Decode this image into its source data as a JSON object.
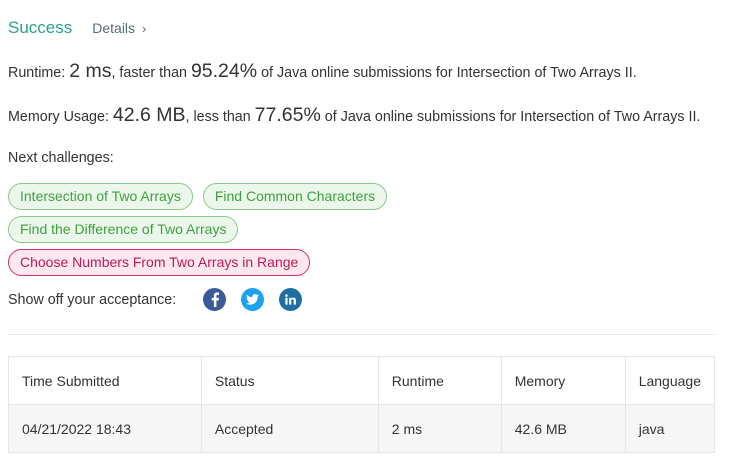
{
  "header": {
    "status": "Success",
    "details_label": "Details",
    "chevron_glyph": "›",
    "status_color": "#2aa391"
  },
  "runtime": {
    "label": "Runtime:",
    "value": "2 ms",
    "mid": ", faster than",
    "percent": "95.24%",
    "suffix": "of Java online submissions for Intersection of Two Arrays II."
  },
  "memory": {
    "label": "Memory Usage:",
    "value": "42.6 MB",
    "mid": ", less than",
    "percent": "77.65%",
    "suffix": "of Java online submissions for Intersection of Two Arrays II."
  },
  "next_challenges": {
    "label": "Next challenges:",
    "items": [
      {
        "label": "Intersection of Two Arrays",
        "difficulty_color": "green"
      },
      {
        "label": "Find Common Characters",
        "difficulty_color": "green"
      },
      {
        "label": "Find the Difference of Two Arrays",
        "difficulty_color": "green"
      },
      {
        "label": "Choose Numbers From Two Arrays in Range",
        "difficulty_color": "red"
      }
    ]
  },
  "share": {
    "label": "Show off your acceptance:",
    "icons": [
      "facebook-icon",
      "twitter-icon",
      "linkedin-icon"
    ]
  },
  "table": {
    "headers": [
      "Time Submitted",
      "Status",
      "Runtime",
      "Memory",
      "Language"
    ],
    "rows": [
      [
        "04/21/2022 18:43",
        "Accepted",
        "2 ms",
        "42.6 MB",
        "java"
      ]
    ]
  }
}
